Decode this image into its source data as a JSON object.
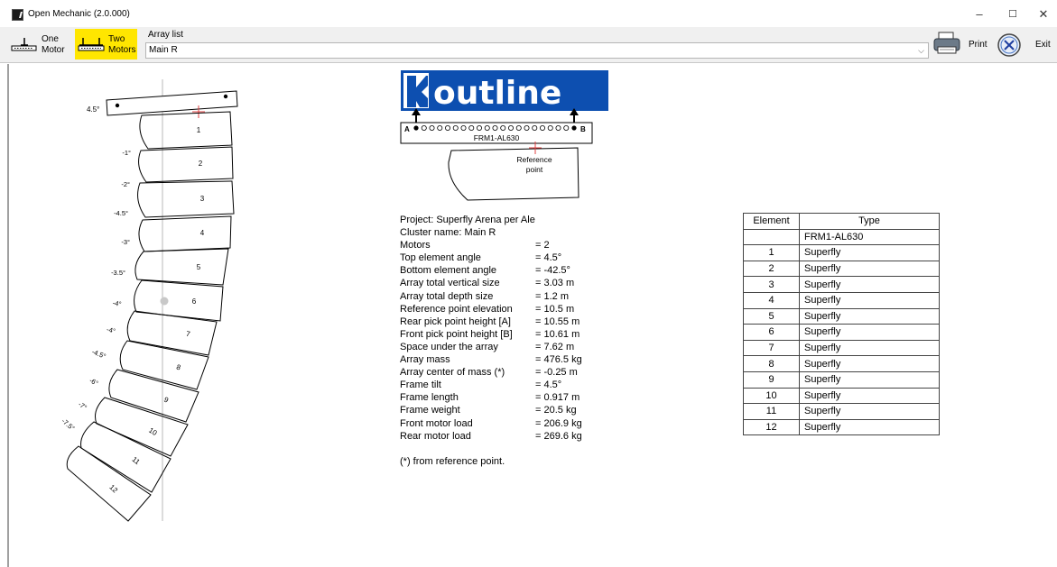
{
  "window": {
    "title": "Open Mechanic (2.0.000)",
    "minimize": "–",
    "maximize": "☐",
    "close": "✕"
  },
  "toolbar": {
    "one_motor": [
      "One",
      "Motor"
    ],
    "two_motors": [
      "Two",
      "Motors"
    ],
    "two_motors_highlight": "#ffe600",
    "array_list_label": "Array list",
    "array_list_value": "Main R",
    "print_label": "Print",
    "exit_label": "Exit"
  },
  "logo": {
    "brand": "outline",
    "brand_color": "#0d4fb0",
    "frame_model": "FRM1-AL630",
    "point_a": "A",
    "point_b": "B",
    "reference_point": [
      "Reference",
      "point"
    ]
  },
  "drawing": {
    "frame_angle": "4.5°",
    "elements": [
      {
        "label": "1",
        "angle": "-1°"
      },
      {
        "label": "2",
        "angle": "-2°"
      },
      {
        "label": "3",
        "angle": "-4.5°"
      },
      {
        "label": "4",
        "angle": "-3°"
      },
      {
        "label": "5",
        "angle": "-3.5°"
      },
      {
        "label": "6",
        "angle": "-4°"
      },
      {
        "label": "7",
        "angle": "-4°"
      },
      {
        "label": "8",
        "angle": "-4.5°"
      },
      {
        "label": "9",
        "angle": "-6°"
      },
      {
        "label": "10",
        "angle": "-7°"
      },
      {
        "label": "11",
        "angle": "-7.5°"
      },
      {
        "label": "12",
        "angle": ""
      }
    ]
  },
  "info": {
    "rows": [
      {
        "label": "Project: Superfly Arena per Ale",
        "value": ""
      },
      {
        "label": "Cluster name: Main R",
        "value": ""
      },
      {
        "label": "Motors",
        "value": "= 2"
      },
      {
        "label": "Top element angle",
        "value": "= 4.5°"
      },
      {
        "label": "Bottom element angle",
        "value": "= -42.5°"
      },
      {
        "label": "Array total vertical size",
        "value": "= 3.03 m"
      },
      {
        "label": "Array total depth size",
        "value": "= 1.2 m"
      },
      {
        "label": "Reference point elevation",
        "value": "= 10.5 m"
      },
      {
        "label": "Rear pick point height [A]",
        "value": "= 10.55 m"
      },
      {
        "label": "Front pick point height [B]",
        "value": "= 10.61 m"
      },
      {
        "label": "Space under the array",
        "value": "= 7.62 m"
      },
      {
        "label": "Array mass",
        "value": "= 476.5 kg"
      },
      {
        "label": "Array center of mass (*)",
        "value": "= -0.25 m"
      },
      {
        "label": "Frame tilt",
        "value": "= 4.5°"
      },
      {
        "label": "Frame length",
        "value": "= 0.917 m"
      },
      {
        "label": "Frame weight",
        "value": "= 20.5 kg"
      },
      {
        "label": "Front motor load",
        "value": "= 206.9 kg"
      },
      {
        "label": "Rear motor load",
        "value": "= 269.6 kg"
      }
    ],
    "footnote": "(*) from reference point."
  },
  "table": {
    "headers": [
      "Element",
      "Type"
    ],
    "rows": [
      [
        "",
        "FRM1-AL630"
      ],
      [
        "1",
        "Superfly"
      ],
      [
        "2",
        "Superfly"
      ],
      [
        "3",
        "Superfly"
      ],
      [
        "4",
        "Superfly"
      ],
      [
        "5",
        "Superfly"
      ],
      [
        "6",
        "Superfly"
      ],
      [
        "7",
        "Superfly"
      ],
      [
        "8",
        "Superfly"
      ],
      [
        "9",
        "Superfly"
      ],
      [
        "10",
        "Superfly"
      ],
      [
        "11",
        "Superfly"
      ],
      [
        "12",
        "Superfly"
      ]
    ]
  }
}
